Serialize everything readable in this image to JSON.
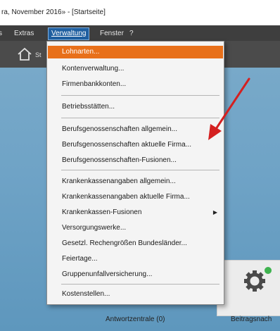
{
  "window": {
    "title": "ra, November 2016» - [Startseite]"
  },
  "menubar": {
    "items": [
      {
        "label": "Extras"
      },
      {
        "label": "Verwaltung"
      },
      {
        "label": "Fenster"
      },
      {
        "label": "?"
      }
    ]
  },
  "toolbar": {
    "start_label": "St"
  },
  "dropdown": {
    "items": [
      {
        "label": "Lohnarten...",
        "highlighted": true
      },
      {
        "label": "Kontenverwaltung..."
      },
      {
        "label": "Firmenbankkonten..."
      },
      {
        "label": "Betriebsstätten..."
      },
      {
        "label": "Berufsgenossenschaften allgemein..."
      },
      {
        "label": "Berufsgenossenschaften aktuelle Firma..."
      },
      {
        "label": "Berufsgenossenschaften-Fusionen..."
      },
      {
        "label": "Krankenkassenangaben allgemein..."
      },
      {
        "label": "Krankenkassenangaben aktuelle Firma..."
      },
      {
        "label": "Krankenkassen-Fusionen",
        "submenu": true
      },
      {
        "label": "Versorgungswerke..."
      },
      {
        "label": "Gesetzl. Rechengrößen Bundesländer..."
      },
      {
        "label": "Feiertage..."
      },
      {
        "label": "Gruppenunfallversicherung..."
      },
      {
        "label": "Kostenstellen..."
      }
    ]
  },
  "tiles": {
    "answer_center": "Antwortzentrale (0)",
    "contributions": "Beitragsnach"
  },
  "colors": {
    "menubar": "#3e3e3e",
    "highlight": "#e8701a",
    "workspace": "#6fa3c6",
    "arrow": "#d42020",
    "gear": "#4a4a4a",
    "gear_badge": "#3fb34f"
  }
}
